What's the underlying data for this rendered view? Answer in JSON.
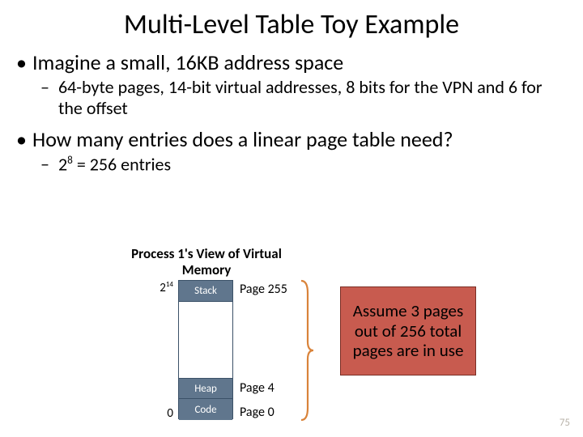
{
  "title": "Multi-Level Table Toy Example",
  "bullets": {
    "b1a": "Imagine a small, 16KB address space",
    "b2a": "64-byte pages, 14-bit virtual addresses, 8 bits for the VPN and 6 for the offset",
    "b1b": "How many entries does a linear page table need?",
    "b2b_pre": "2",
    "b2b_sup": "8",
    "b2b_post": " = 256 entries"
  },
  "diagram": {
    "title": "Process 1's View of Virtual Memory",
    "left_top_base": "2",
    "left_top_exp": "14",
    "left_bottom": "0",
    "seg_stack": "Stack",
    "seg_heap": "Heap",
    "seg_code": "Code",
    "page255": "Page 255",
    "page4": "Page 4",
    "page0": "Page 0",
    "callout": "Assume 3 pages out of 256 total pages are in use"
  },
  "page_number": "75"
}
